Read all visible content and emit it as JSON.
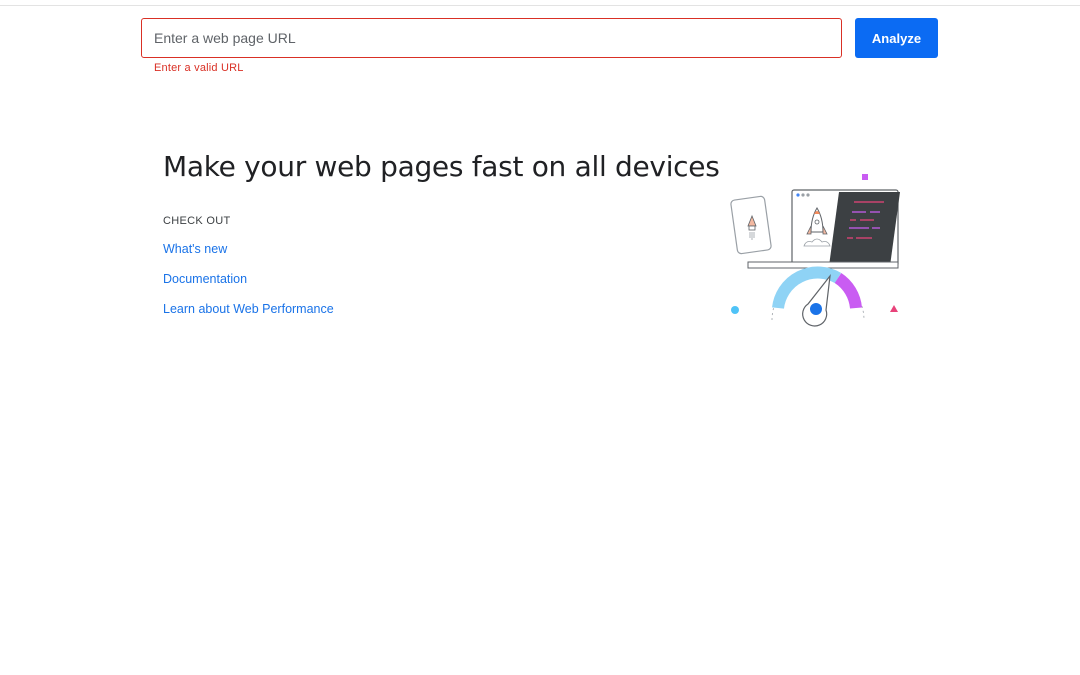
{
  "search": {
    "placeholder": "Enter a web page URL",
    "value": "",
    "error": "Enter a valid URL",
    "button_label": "Analyze"
  },
  "hero": {
    "title": "Make your web pages fast on all devices",
    "checkout_label": "CHECK OUT",
    "links": [
      {
        "label": "What's new"
      },
      {
        "label": "Documentation"
      },
      {
        "label": "Learn about Web Performance"
      }
    ],
    "illustration_icon": "performance-gauge-illustration"
  },
  "colors": {
    "accent": "#0b6bf3",
    "link": "#1a73e8",
    "error": "#d93025",
    "text": "#202124"
  }
}
